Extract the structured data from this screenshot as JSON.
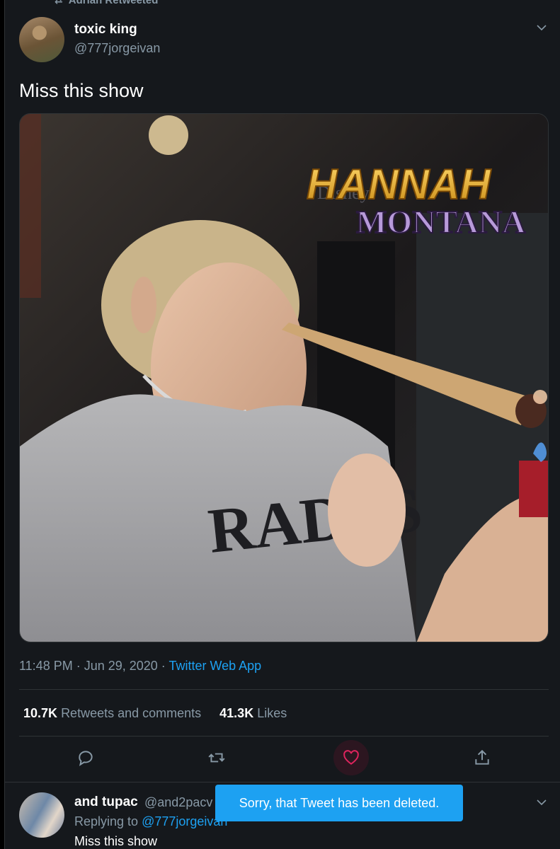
{
  "retweet": {
    "label": "Adrian Retweeted"
  },
  "tweet": {
    "author_name": "toxic king",
    "author_handle": "@777jorgeivan",
    "text": "Miss this show",
    "time": "11:48 PM · Jun 29, 2020 · ",
    "source": "Twitter Web App",
    "retweets_count": "10.7K",
    "retweets_label": "Retweets and comments",
    "likes_count": "41.3K",
    "likes_label": "Likes",
    "media": {
      "logo_line1": "HANNAH",
      "logo_line2": "MONTANA",
      "logo_small": "Disney",
      "shirt_text": "RAD IS"
    }
  },
  "actions": [
    {
      "name": "reply",
      "icon": "speech-bubble-icon"
    },
    {
      "name": "retweet",
      "icon": "retweet-icon"
    },
    {
      "name": "like",
      "icon": "heart-icon",
      "active": true
    },
    {
      "name": "share",
      "icon": "share-icon"
    }
  ],
  "reply": {
    "author_name": "and tupac",
    "author_handle": "@and2pacv",
    "replying_prefix": "Replying to ",
    "replying_to": "@777jorgeivan",
    "text": "Miss this show"
  },
  "toast": {
    "message": "Sorry, that Tweet has been deleted."
  },
  "colors": {
    "accent": "#1da1f2",
    "like": "#e0245e",
    "background": "#15181c",
    "muted": "#8899a6"
  }
}
